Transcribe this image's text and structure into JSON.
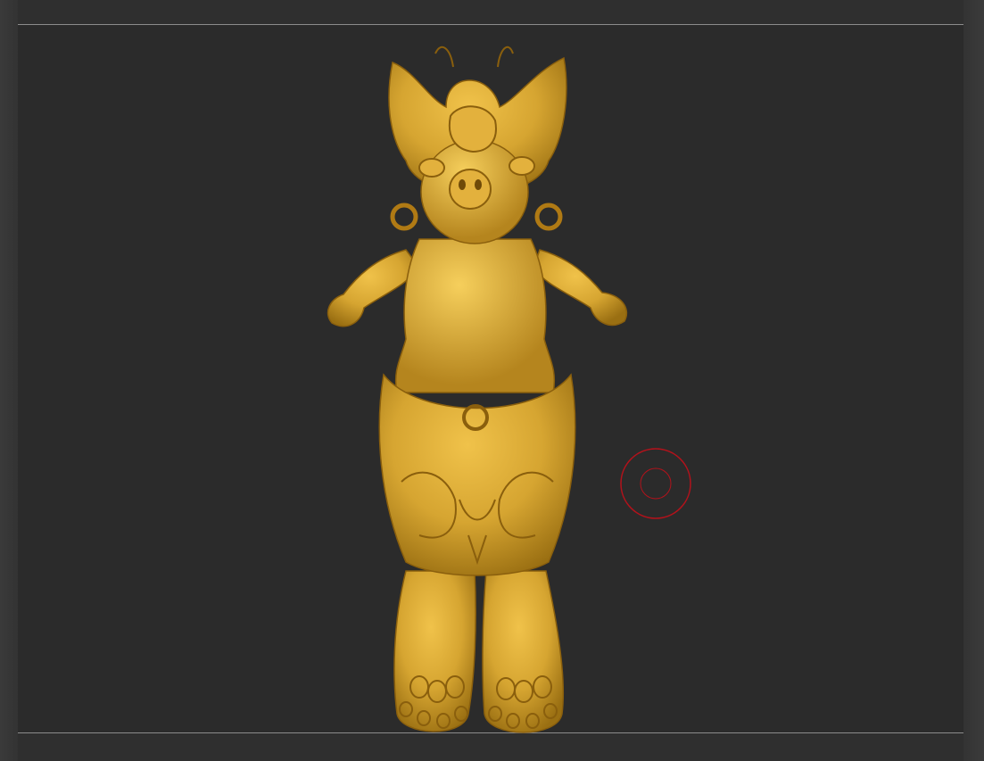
{
  "app": {
    "viewport": "3d-sculpt-canvas",
    "model": "golden-sculpt-figure",
    "material_color": "#d6a531",
    "background_color": "#2b2b2b",
    "cursor_color": "#b3121b"
  }
}
